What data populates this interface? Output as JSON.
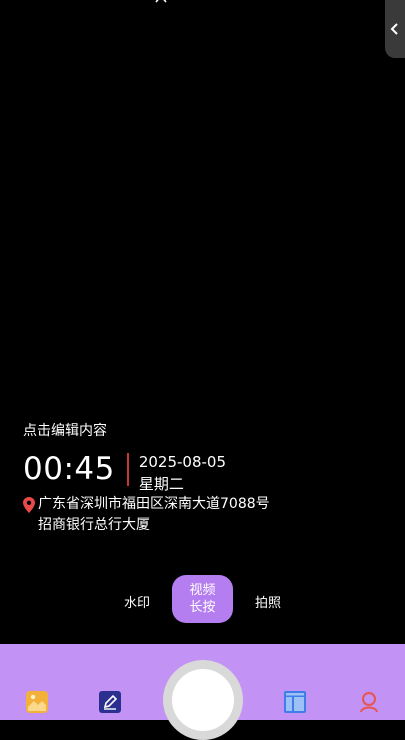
{
  "colors": {
    "background": "#000000",
    "bottom_bar": "#c292f4",
    "active_mode": "#b57ef0",
    "divider": "#c63838",
    "pin": "#e84a4a"
  },
  "watermark": {
    "edit_hint": "点击编辑内容",
    "time": "00:45",
    "date": "2025-08-05",
    "weekday": "星期二",
    "address_line1": "广东省深圳市福田区深南大道7088号",
    "address_line2": "招商银行总行大厦"
  },
  "modes": {
    "watermark_label": "水印",
    "video_label_line1": "视频",
    "video_label_line2": "长按",
    "photo_label": "拍照",
    "active": "视频"
  },
  "icons": {
    "top": "chevron-up-icon",
    "back": "chevron-left-icon",
    "toolbar": [
      "gallery-icon",
      "edit-icon",
      "layout-icon",
      "profile-icon"
    ]
  }
}
